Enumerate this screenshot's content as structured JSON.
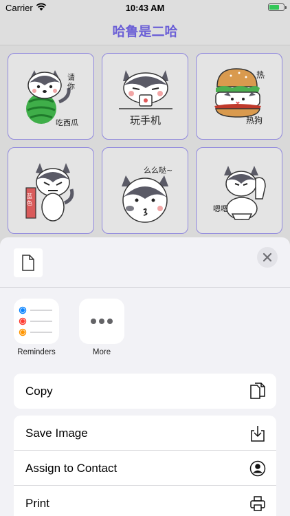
{
  "status_bar": {
    "carrier": "Carrier",
    "time": "10:43 AM",
    "battery_level": 0.7
  },
  "nav": {
    "title": "哈鲁是二哈"
  },
  "stickers": [
    {
      "name": "watermelon-husky",
      "caption_1": "请你",
      "caption_2": "吃西瓜"
    },
    {
      "name": "phone-husky",
      "caption_1": "玩手机"
    },
    {
      "name": "hotdog-husky",
      "caption_1": "热",
      "caption_2": "热狗"
    },
    {
      "name": "sign-husky",
      "caption_1": "蓝色"
    },
    {
      "name": "kiss-husky",
      "caption_1": "么么哒~"
    },
    {
      "name": "toilet-husky",
      "caption_1": "嗯嗯"
    }
  ],
  "share_sheet": {
    "apps": [
      {
        "label": "Reminders",
        "icon": "reminders-icon"
      },
      {
        "label": "More",
        "icon": "more-icon"
      }
    ],
    "actions_group_1": [
      {
        "label": "Copy",
        "icon": "copy-icon"
      }
    ],
    "actions_group_2": [
      {
        "label": "Save Image",
        "icon": "save-icon"
      },
      {
        "label": "Assign to Contact",
        "icon": "contact-icon"
      },
      {
        "label": "Print",
        "icon": "print-icon"
      }
    ],
    "colors": {
      "reminder_blue": "#0a84ff",
      "reminder_red": "#ff3b30",
      "reminder_orange": "#ff9500"
    }
  },
  "colors": {
    "title": "#6b5fd6",
    "cell_border": "#8f87dd"
  }
}
